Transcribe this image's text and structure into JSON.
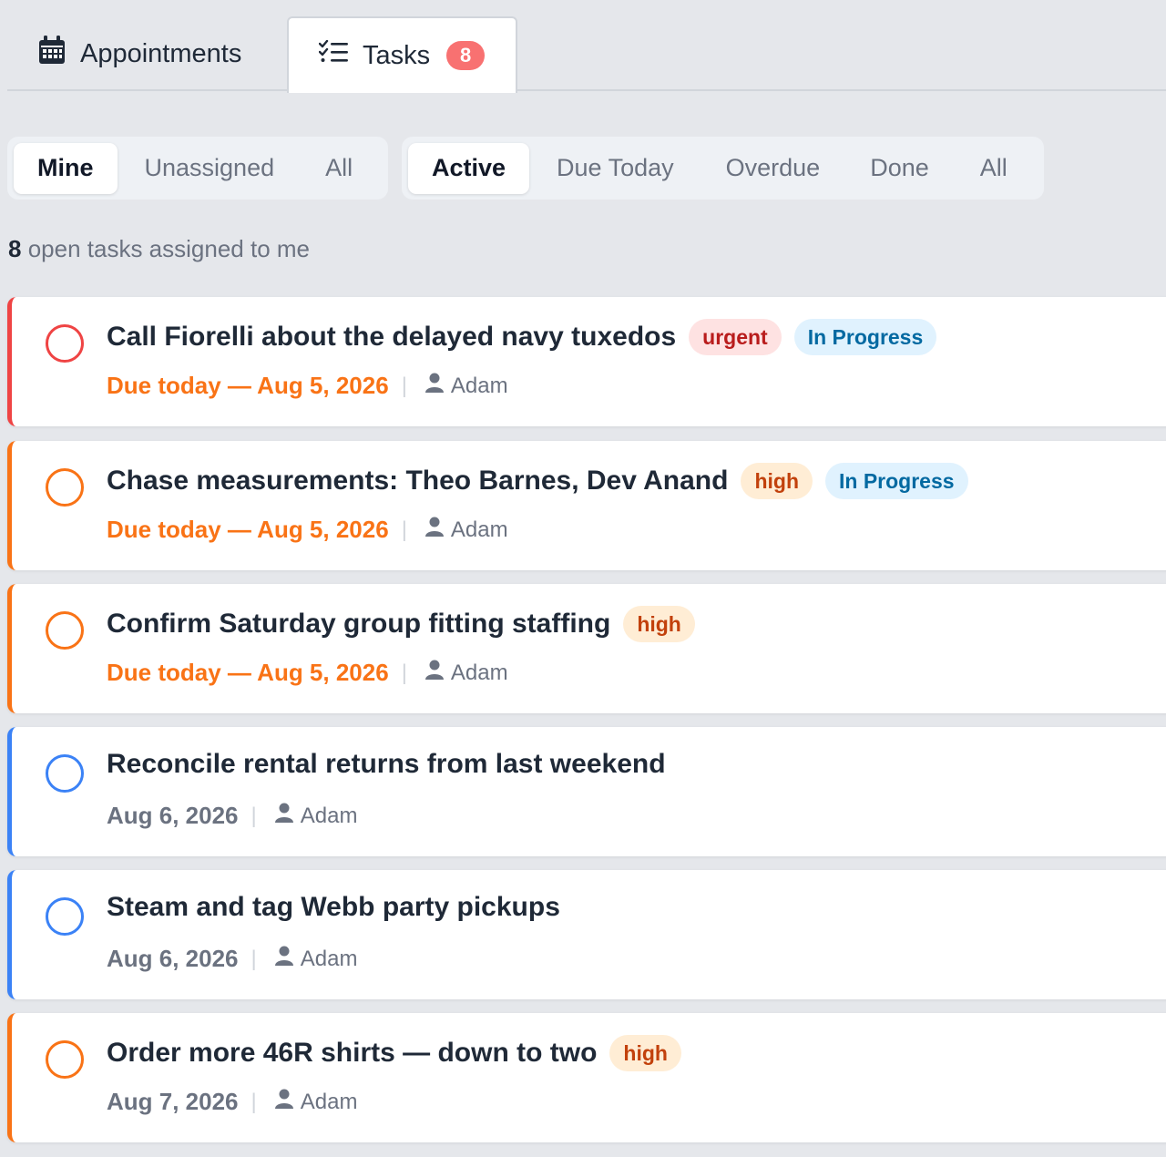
{
  "tabs": {
    "appointments": {
      "label": "Appointments",
      "icon": "calendar-icon"
    },
    "tasks": {
      "label": "Tasks",
      "count": "8",
      "icon": "task-list-icon"
    }
  },
  "filters": {
    "owner": [
      "Mine",
      "Unassigned",
      "All"
    ],
    "owner_selected": "Mine",
    "status": [
      "Active",
      "Due Today",
      "Overdue",
      "Done",
      "All"
    ],
    "status_selected": "Active"
  },
  "summary": {
    "count": "8",
    "text": "open tasks assigned to me"
  },
  "tasks": [
    {
      "title": "Call Fiorelli about the delayed navy tuxedos",
      "priority": "urgent",
      "status": "In Progress",
      "due": "Due today — Aug 5, 2026",
      "assignee": "Adam"
    },
    {
      "title": "Chase measurements: Theo Barnes, Dev Anand",
      "priority": "high",
      "status": "In Progress",
      "due": "Due today — Aug 5, 2026",
      "assignee": "Adam"
    },
    {
      "title": "Confirm Saturday group fitting staffing",
      "priority": "high",
      "status": "",
      "due": "Due today — Aug 5, 2026",
      "assignee": "Adam"
    },
    {
      "title": "Reconcile rental returns from last weekend",
      "priority": "",
      "status": "",
      "due": "Aug 6, 2026",
      "assignee": "Adam"
    },
    {
      "title": "Steam and tag Webb party pickups",
      "priority": "",
      "status": "",
      "due": "Aug 6, 2026",
      "assignee": "Adam"
    },
    {
      "title": "Order more 46R shirts — down to two",
      "priority": "high",
      "status": "",
      "due": "Aug 7, 2026",
      "assignee": "Adam"
    }
  ],
  "colors": {
    "urgent": "#ef4444",
    "high": "#f97316",
    "normal": "#3b82f6",
    "badge_count": "#f87171"
  }
}
